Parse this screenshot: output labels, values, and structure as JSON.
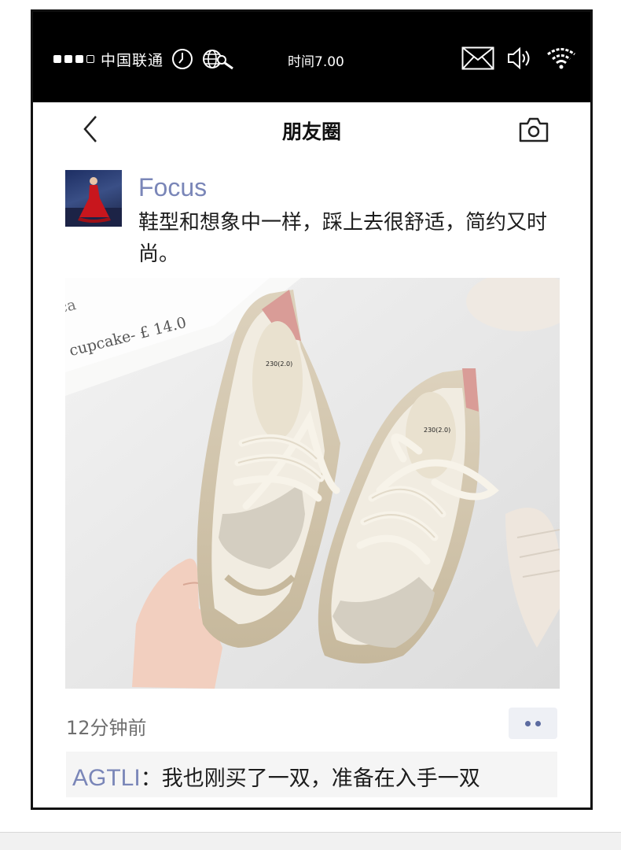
{
  "status_bar": {
    "carrier": "中国联通",
    "time": "时间7.00",
    "icons": [
      "signal-dots",
      "clock-icon",
      "globe-search-icon",
      "mail-icon",
      "speaker-icon",
      "wifi-icon"
    ]
  },
  "nav": {
    "title": "朋友圈",
    "back_icon": "chevron-left-icon",
    "camera_icon": "camera-icon"
  },
  "post": {
    "author": "Focus",
    "text": "鞋型和想象中一样，踩上去很舒适，简约又时尚。",
    "image_caption": "cupcake- £ 14.0",
    "image_fragment": "ca",
    "insole_label": "230(2.0)",
    "timestamp": "12分钟前",
    "more_icon": "more-dots-icon"
  },
  "comment": {
    "author": "AGTLI",
    "separator": "：",
    "text": "我也刚买了一双，准备在入手一双"
  },
  "colors": {
    "name_accent": "#7a86b8",
    "status_bar_bg": "#000000"
  }
}
